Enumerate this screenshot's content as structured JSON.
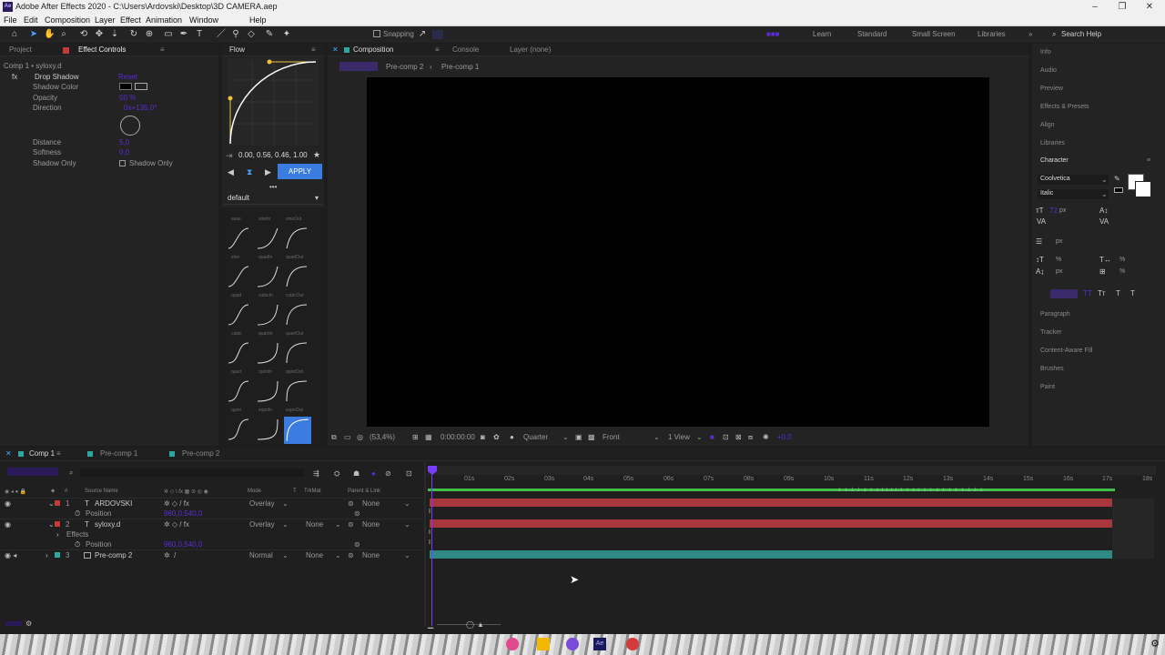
{
  "window": {
    "title": "Adobe After Effects 2020 - C:\\Users\\Ardovski\\Desktop\\3D CAMERA.aep",
    "logo": "Ae"
  },
  "menu": [
    "File",
    "Edit",
    "Composition",
    "Layer",
    "Effect",
    "Animation",
    "Window",
    "Help"
  ],
  "toolbar": {
    "snapping": "Snapping",
    "workspaces": [
      "Learn",
      "Standard",
      "Small Screen",
      "Libraries"
    ],
    "search_placeholder": "Search Help"
  },
  "left_panel": {
    "tabs": {
      "project": "Project",
      "effect_controls": "Effect Controls"
    },
    "layer_path": "Comp 1 • syloxy.d",
    "effect_name": "Drop Shadow",
    "fx_badge": "fx",
    "properties": [
      "Shadow Color",
      "Opacity",
      "Direction",
      "Distance",
      "Softness",
      "Shadow Only"
    ],
    "shadow_only_checkbox": "Shadow Only"
  },
  "flow": {
    "title": "Flow",
    "curve_values": "0.00, 0.56, 0.46, 1.00",
    "apply_label": "APPLY",
    "preset": "default",
    "easing_labels": [
      [
        "ease",
        "sineIn",
        "sineOut"
      ],
      [
        "sine",
        "quadIn",
        "quadOut"
      ],
      [
        "quad",
        "cubicIn",
        "cubicOut"
      ],
      [
        "cubic",
        "quartIn",
        "quartOut"
      ],
      [
        "quart",
        "quintIn",
        "quintOut"
      ],
      [
        "quint",
        "expoIn",
        "expoOut"
      ]
    ]
  },
  "composition": {
    "tab": "Composition",
    "console_tab": "Console",
    "layer_tab": "Layer (none)",
    "breadcrumbs": [
      "Pre-comp 2",
      "Pre-comp 1"
    ],
    "zoom": "(53,4%)",
    "timecode": "0:00:00:00",
    "resolution": "Quarter",
    "view": "Front",
    "views": "1 View"
  },
  "right_panel": {
    "items_top": [
      "Info",
      "Audio",
      "Preview",
      "Effects & Presets",
      "Align",
      "Libraries"
    ],
    "character": {
      "title": "Character",
      "font": "Coolvetica",
      "style": "Italic",
      "px": "px",
      "percent": "%",
      "style_buttons": [
        "Tт",
        "T",
        "T"
      ]
    },
    "items_bottom": [
      "Paragraph",
      "Tracker",
      "Content-Aware Fill",
      "Brushes",
      "Paint"
    ]
  },
  "timeline": {
    "tabs": [
      "Comp 1",
      "Pre-comp 1",
      "Pre-comp 2"
    ],
    "columns": [
      "Source Name",
      "Mode",
      "T",
      "TrkMat",
      "Parent & Link"
    ],
    "layers": [
      {
        "num": "1",
        "type": "T",
        "name": "ARDOVSKI",
        "mode": "Overlay",
        "trkmat": "",
        "parent": "None",
        "sub": "Position"
      },
      {
        "num": "2",
        "type": "T",
        "name": "syloxy.d",
        "mode": "Overlay",
        "trkmat": "None",
        "parent": "None",
        "sub1": "Effects",
        "sub2": "Position"
      },
      {
        "num": "3",
        "type": "",
        "name": "Pre-comp 2",
        "mode": "Normal",
        "trkmat": "None",
        "parent": "None"
      }
    ],
    "ruler": [
      "01s",
      "02s",
      "03s",
      "04s",
      "05s",
      "06s",
      "07s",
      "08s",
      "09s",
      "10s",
      "11s",
      "12s",
      "13s",
      "14s",
      "15s",
      "16s",
      "17s",
      "18s"
    ],
    "colors": {
      "red_bar": "#a8363d",
      "teal_bar": "#2f8a86",
      "green_line": "#3fbf4a",
      "playhead": "#7a3cff"
    }
  }
}
